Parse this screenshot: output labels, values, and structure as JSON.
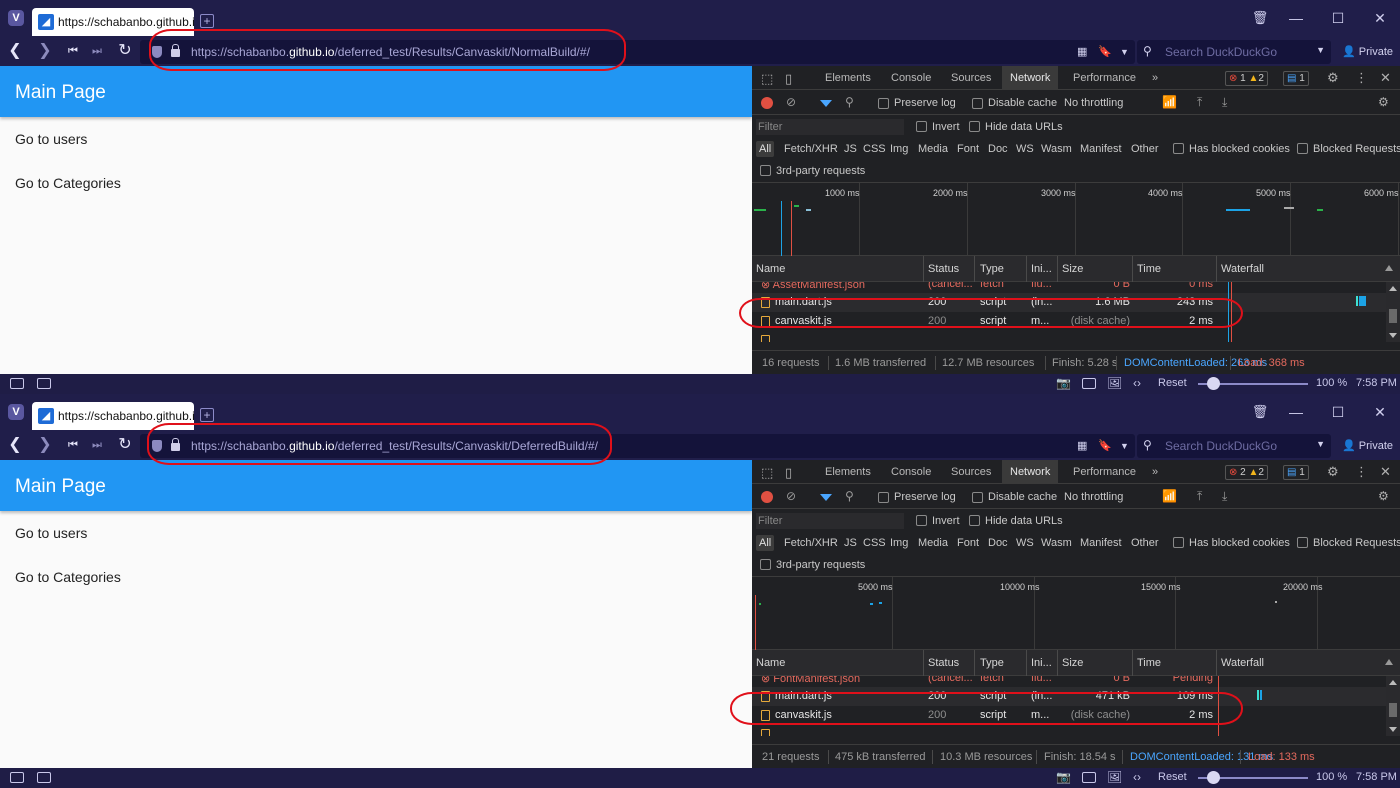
{
  "windows": [
    {
      "tab_title": "https://schabanbo.github.io",
      "url_pre": "https://schabanbo.",
      "url_host": "github.io",
      "url_post": "/deferred_test/Results/Canvaskit/NormalBuild/#/",
      "search_placeholder": "Search DuckDuckGo",
      "private_label": "Private",
      "app_title": "Main Page",
      "link_users": "Go to users",
      "link_categories": "Go to Categories",
      "devtools": {
        "tabs": [
          "Elements",
          "Console",
          "Sources",
          "Network",
          "Performance",
          "»"
        ],
        "active_tab": "Network",
        "errors": "1",
        "warnings": "2",
        "messages": "1",
        "preserve_log": "Preserve log",
        "disable_cache": "Disable cache",
        "throttling": "No throttling",
        "filter_placeholder": "Filter",
        "invert": "Invert",
        "hide_data_urls": "Hide data URLs",
        "types": [
          "All",
          "Fetch/XHR",
          "JS",
          "CSS",
          "Img",
          "Media",
          "Font",
          "Doc",
          "WS",
          "Wasm",
          "Manifest",
          "Other"
        ],
        "has_blocked_cookies": "Has blocked cookies",
        "blocked_requests": "Blocked Requests",
        "third_party": "3rd-party requests",
        "timeline_labels": [
          "1000 ms",
          "2000 ms",
          "3000 ms",
          "4000 ms",
          "5000 ms",
          "6000 ms"
        ],
        "columns": [
          "Name",
          "Status",
          "Type",
          "Ini...",
          "Size",
          "Time",
          "Waterfall"
        ],
        "rows": [
          {
            "name": "AssetManifest.json",
            "status": "(cancel...",
            "type": "fetch",
            "initiator": "flu...",
            "size": "0 B",
            "time": "0 ms"
          },
          {
            "name": "main.dart.js",
            "status": "200",
            "type": "script",
            "initiator": "(in...",
            "size": "1.6 MB",
            "time": "243 ms"
          },
          {
            "name": "canvaskit.js",
            "status": "200",
            "type": "script",
            "initiator": "m...",
            "size": "(disk cache)",
            "time": "2 ms"
          },
          {
            "name": "",
            "status": "",
            "type": "",
            "initiator": "",
            "size": "",
            "time": ""
          }
        ],
        "summary": {
          "requests": "16 requests",
          "transferred": "1.6 MB transferred",
          "resources": "12.7 MB resources",
          "finish": "Finish: 5.28 s",
          "dcl": "DOMContentLoaded: 263 ms",
          "load": "Load: 368 ms"
        }
      },
      "status": {
        "reset": "Reset",
        "zoom": "100 %",
        "time": "7:58 PM"
      }
    },
    {
      "tab_title": "https://schabanbo.github.io",
      "url_pre": "https://schabanbo.",
      "url_host": "github.io",
      "url_post": "/deferred_test/Results/Canvaskit/DeferredBuild/#/",
      "search_placeholder": "Search DuckDuckGo",
      "private_label": "Private",
      "app_title": "Main Page",
      "link_users": "Go to users",
      "link_categories": "Go to Categories",
      "devtools": {
        "tabs": [
          "Elements",
          "Console",
          "Sources",
          "Network",
          "Performance",
          "»"
        ],
        "active_tab": "Network",
        "errors": "2",
        "warnings": "2",
        "messages": "1",
        "preserve_log": "Preserve log",
        "disable_cache": "Disable cache",
        "throttling": "No throttling",
        "filter_placeholder": "Filter",
        "invert": "Invert",
        "hide_data_urls": "Hide data URLs",
        "types": [
          "All",
          "Fetch/XHR",
          "JS",
          "CSS",
          "Img",
          "Media",
          "Font",
          "Doc",
          "WS",
          "Wasm",
          "Manifest",
          "Other"
        ],
        "has_blocked_cookies": "Has blocked cookies",
        "blocked_requests": "Blocked Requests",
        "third_party": "3rd-party requests",
        "timeline_labels": [
          "5000 ms",
          "10000 ms",
          "15000 ms",
          "20000 ms"
        ],
        "columns": [
          "Name",
          "Status",
          "Type",
          "Ini...",
          "Size",
          "Time",
          "Waterfall"
        ],
        "rows": [
          {
            "name": "FontManifest.json",
            "status": "(cancel...",
            "type": "fetch",
            "initiator": "flu...",
            "size": "0 B",
            "time": "Pending"
          },
          {
            "name": "main.dart.js",
            "status": "200",
            "type": "script",
            "initiator": "(in...",
            "size": "471 kB",
            "time": "109 ms"
          },
          {
            "name": "canvaskit.js",
            "status": "200",
            "type": "script",
            "initiator": "m...",
            "size": "(disk cache)",
            "time": "2 ms"
          },
          {
            "name": "",
            "status": "",
            "type": "",
            "initiator": "",
            "size": "",
            "time": ""
          }
        ],
        "summary": {
          "requests": "21 requests",
          "transferred": "475 kB transferred",
          "resources": "10.3 MB resources",
          "finish": "Finish: 18.54 s",
          "dcl": "DOMContentLoaded: 131 ms",
          "load": "Load: 133 ms"
        }
      },
      "status": {
        "reset": "Reset",
        "zoom": "100 %",
        "time": "7:58 PM"
      }
    }
  ],
  "colors": {
    "accent": "#2196f3",
    "browser_chrome": "#201e4a",
    "highlight": "#e0101a",
    "devtools_bg": "#202124"
  }
}
